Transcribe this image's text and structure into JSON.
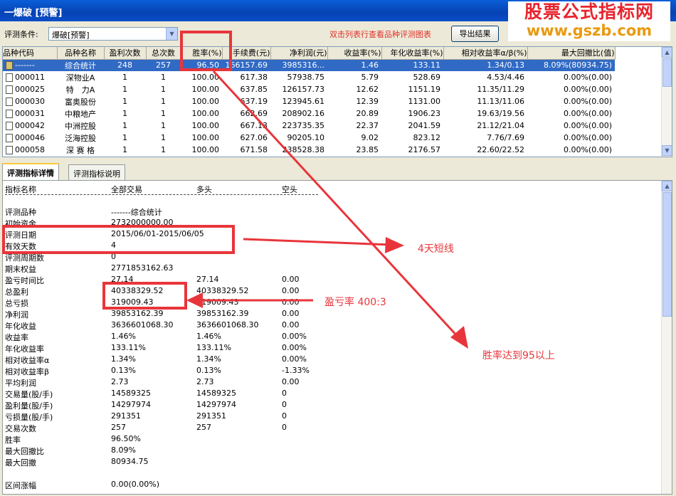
{
  "window": {
    "title": "一爆破 [预警]"
  },
  "watermark": {
    "line1": "股票公式指标网",
    "line2": "www.gszb.com"
  },
  "toolbar": {
    "condition_label": "评测条件:",
    "condition_value": "爆破[预警]",
    "hint": "双击列表行查看品种评测图表",
    "export_label": "导出结果"
  },
  "table": {
    "headers": [
      "品种代码",
      "品种名称",
      "盈利次数",
      "总次数",
      "胜率(%)",
      "手续费(元)",
      "净利润(元)",
      "收益率(%)",
      "年化收益率(%)",
      "相对收益率α/β(%)",
      "最大回撤比(值)"
    ],
    "rows": [
      [
        "-------",
        "综合统计",
        "248",
        "257",
        "96.50",
        "166157.69",
        "3985316...",
        "1.46",
        "133.11",
        "1.34/0.13",
        "8.09%(80934.75)"
      ],
      [
        "000011",
        "深物业A",
        "1",
        "1",
        "100.00",
        "617.38",
        "57938.75",
        "5.79",
        "528.69",
        "4.53/4.46",
        "0.00%(0.00)"
      ],
      [
        "000025",
        "特　力A",
        "1",
        "1",
        "100.00",
        "637.85",
        "126157.73",
        "12.62",
        "1151.19",
        "11.35/11.29",
        "0.00%(0.00)"
      ],
      [
        "000030",
        "富奥股份",
        "1",
        "1",
        "100.00",
        "637.19",
        "123945.61",
        "12.39",
        "1131.00",
        "11.13/11.06",
        "0.00%(0.00)"
      ],
      [
        "000031",
        "中粮地产",
        "1",
        "1",
        "100.00",
        "662.69",
        "208902.16",
        "20.89",
        "1906.23",
        "19.63/19.56",
        "0.00%(0.00)"
      ],
      [
        "000042",
        "中洲控股",
        "1",
        "1",
        "100.00",
        "667.13",
        "223735.35",
        "22.37",
        "2041.59",
        "21.12/21.04",
        "0.00%(0.00)"
      ],
      [
        "000046",
        "泛海控股",
        "1",
        "1",
        "100.00",
        "627.06",
        "90205.10",
        "9.02",
        "823.12",
        "7.76/7.69",
        "0.00%(0.00)"
      ],
      [
        "000058",
        "深 赛 格",
        "1",
        "1",
        "100.00",
        "671.58",
        "238528.38",
        "23.85",
        "2176.57",
        "22.60/22.52",
        "0.00%(0.00)"
      ]
    ]
  },
  "tabs": [
    "评测指标详情",
    "评测指标说明"
  ],
  "detail": {
    "header": [
      "指标名称",
      "全部交易",
      "多头",
      "空头"
    ],
    "separator": "-------------------------------------------------------------------------------------",
    "rows": [
      [
        "评测品种",
        "-------综合统计",
        "",
        ""
      ],
      [
        "初始资金",
        "2732000000.00",
        "",
        ""
      ],
      [
        "评测日期",
        "2015/06/01-2015/06/05",
        "",
        ""
      ],
      [
        "有效天数",
        "4",
        "",
        ""
      ],
      [
        "评测周期数",
        "0",
        "",
        ""
      ],
      [
        "期末权益",
        "2771853162.63",
        "",
        ""
      ],
      [
        "盈亏时间比",
        "27.14",
        "27.14",
        "0.00"
      ],
      [
        "总盈利",
        "40338329.52",
        "40338329.52",
        "0.00"
      ],
      [
        "总亏损",
        "319009.43",
        "319009.43",
        "0.00"
      ],
      [
        "净利润",
        "39853162.39",
        "39853162.39",
        "0.00"
      ],
      [
        "年化收益",
        "3636601068.30",
        "3636601068.30",
        "0.00"
      ],
      [
        "收益率",
        "1.46%",
        "1.46%",
        "0.00%"
      ],
      [
        "年化收益率",
        "133.11%",
        "133.11%",
        "0.00%"
      ],
      [
        "相对收益率α",
        "1.34%",
        "1.34%",
        "0.00%"
      ],
      [
        "相对收益率β",
        "0.13%",
        "0.13%",
        "-1.33%"
      ],
      [
        "平均利润",
        "2.73",
        "2.73",
        "0.00"
      ],
      [
        "交易量(股/手)",
        "14589325",
        "14589325",
        "0"
      ],
      [
        "盈利量(股/手)",
        "14297974",
        "14297974",
        "0"
      ],
      [
        "亏损量(股/手)",
        "291351",
        "291351",
        "0"
      ],
      [
        "交易次数",
        "257",
        "257",
        "0"
      ],
      [
        "胜率",
        "96.50%",
        "",
        ""
      ],
      [
        "最大回撤比",
        "8.09%",
        "",
        ""
      ],
      [
        "最大回撤",
        "80934.75",
        "",
        ""
      ],
      [
        "",
        "",
        "",
        ""
      ],
      [
        "区间涨幅",
        "0.00(0.00%)",
        "",
        ""
      ]
    ]
  },
  "annotations": {
    "short_line": "4天短线",
    "profit_loss": "盈亏率 400:3",
    "win_rate": "胜率达到95以上"
  },
  "colors": {
    "annotation": "#e8353b",
    "selected_row": "#316ac5",
    "title_bar": "#0642b4"
  }
}
